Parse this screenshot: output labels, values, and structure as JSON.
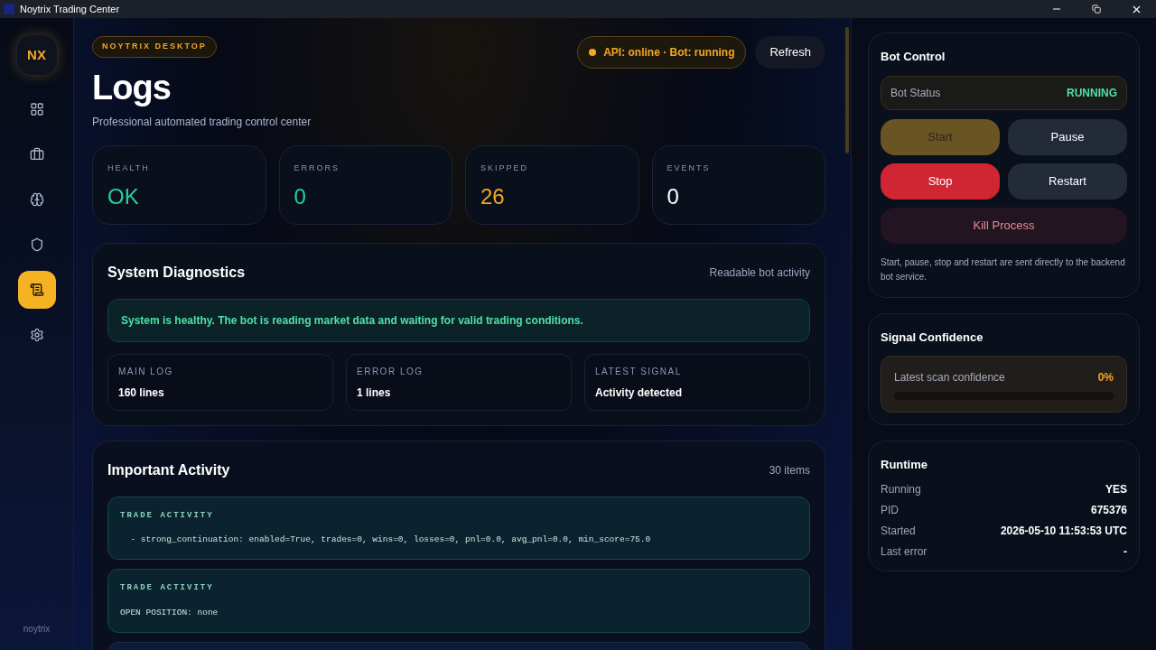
{
  "window": {
    "title": "Noytrix Trading Center"
  },
  "sidebar": {
    "logo": "NX",
    "items": [
      {
        "selected": false
      },
      {
        "selected": false
      },
      {
        "selected": false
      },
      {
        "selected": false
      },
      {
        "selected": true
      },
      {
        "selected": false
      }
    ],
    "footer": "noytrix"
  },
  "header": {
    "badge": "NOYTRIX DESKTOP",
    "title": "Logs",
    "subtitle": "Professional automated trading control center",
    "status": "API: online · Bot: running",
    "refresh": "Refresh"
  },
  "stats": [
    {
      "label": "HEALTH",
      "value": "OK",
      "color": "#22d39a"
    },
    {
      "label": "ERRORS",
      "value": "0",
      "color": "#22d39a"
    },
    {
      "label": "SKIPPED",
      "value": "26",
      "color": "#f5a623"
    },
    {
      "label": "EVENTS",
      "value": "0",
      "color": "#ffffff"
    }
  ],
  "diagnostics": {
    "title": "System Diagnostics",
    "note": "Readable bot activity",
    "message": "System is healthy. The bot is reading market data and waiting for valid trading conditions.",
    "tiles": [
      {
        "label": "MAIN LOG",
        "value": "160 lines"
      },
      {
        "label": "ERROR LOG",
        "value": "1 lines"
      },
      {
        "label": "LATEST SIGNAL",
        "value": "Activity detected"
      }
    ]
  },
  "activity": {
    "title": "Important Activity",
    "count": "30 items",
    "entries": [
      {
        "kind": "trade",
        "label": "TRADE ACTIVITY",
        "text": "  - strong_continuation: enabled=True, trades=0, wins=0, losses=0, pnl=0.0, avg_pnl=0.0, min_score=75.0"
      },
      {
        "kind": "trade",
        "label": "TRADE ACTIVITY",
        "text": "OPEN POSITION: none"
      }
    ]
  },
  "bot_control": {
    "title": "Bot Control",
    "status_label": "Bot Status",
    "status": "RUNNING",
    "buttons": [
      {
        "kind": "primary",
        "label": "Start",
        "disabled": true
      },
      {
        "kind": "secondary",
        "label": "Pause",
        "disabled": false
      },
      {
        "kind": "danger",
        "label": "Stop",
        "disabled": false
      },
      {
        "kind": "secondary",
        "label": "Restart",
        "disabled": false
      },
      {
        "kind": "kill",
        "label": "Kill Process",
        "disabled": false
      }
    ],
    "note": "Start, pause, stop and restart are sent directly to the backend bot service."
  },
  "confidence": {
    "title": "Signal Confidence",
    "label": "Latest scan confidence",
    "value": "0%",
    "level": 0
  },
  "runtime": {
    "title": "Runtime",
    "rows": [
      {
        "label": "Running",
        "value": "YES"
      },
      {
        "label": "PID",
        "value": "675376"
      },
      {
        "label": "Started",
        "value": "2026-05-10 11:53:53 UTC"
      },
      {
        "label": "Last error",
        "value": "-"
      }
    ]
  }
}
